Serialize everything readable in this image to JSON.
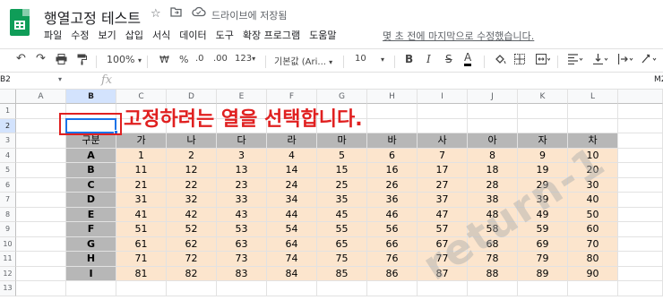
{
  "app": {
    "title": "행열고정 테스트",
    "drive_status": "드라이브에 저장됨",
    "last_edit": "몇 초 전에 마지막으로 수정했습니다.",
    "menu": [
      "파일",
      "수정",
      "보기",
      "삽입",
      "서식",
      "데이터",
      "도구",
      "확장 프로그램",
      "도움말"
    ]
  },
  "toolbar": {
    "zoom": "100%",
    "currency": "₩",
    "percent": "%",
    "dec_decrease": ".0",
    "dec_increase": ".00",
    "more_formats": "123",
    "font": "기본값 (Ari...",
    "font_size": "10",
    "bold": "B",
    "italic": "I",
    "strike": "S",
    "text_color": "A"
  },
  "formula_bar": {
    "name_box": "B2",
    "fx": "fx",
    "value": "M2"
  },
  "sheet": {
    "columns": [
      "A",
      "B",
      "C",
      "D",
      "E",
      "F",
      "G",
      "H",
      "I",
      "J",
      "K",
      "L"
    ],
    "rows": [
      "1",
      "2",
      "3",
      "4",
      "5",
      "6",
      "7",
      "8",
      "9",
      "10",
      "11",
      "12",
      "13"
    ],
    "selected_col": "B",
    "selected_row": "2",
    "header_label": "구분",
    "col_labels": [
      "가",
      "나",
      "다",
      "라",
      "마",
      "바",
      "사",
      "아",
      "자",
      "차"
    ],
    "row_labels": [
      "A",
      "B",
      "C",
      "D",
      "E",
      "F",
      "G",
      "H",
      "I"
    ],
    "values": [
      [
        "1",
        "2",
        "3",
        "4",
        "5",
        "6",
        "7",
        "8",
        "9",
        "10"
      ],
      [
        "11",
        "12",
        "13",
        "14",
        "15",
        "16",
        "17",
        "18",
        "19",
        "20"
      ],
      [
        "21",
        "22",
        "23",
        "24",
        "25",
        "26",
        "27",
        "28",
        "29",
        "30"
      ],
      [
        "31",
        "32",
        "33",
        "34",
        "35",
        "36",
        "37",
        "38",
        "39",
        "40"
      ],
      [
        "41",
        "42",
        "43",
        "44",
        "45",
        "46",
        "47",
        "48",
        "49",
        "50"
      ],
      [
        "51",
        "52",
        "53",
        "54",
        "55",
        "56",
        "57",
        "58",
        "59",
        "60"
      ],
      [
        "61",
        "62",
        "63",
        "64",
        "65",
        "66",
        "67",
        "68",
        "69",
        "70"
      ],
      [
        "71",
        "72",
        "73",
        "74",
        "75",
        "76",
        "77",
        "78",
        "79",
        "80"
      ],
      [
        "81",
        "82",
        "83",
        "84",
        "85",
        "86",
        "87",
        "88",
        "89",
        "90"
      ]
    ]
  },
  "annotation": "고정하려는 열을 선택합니다.",
  "watermark": "return-1",
  "colors": {
    "header_gray": "#b7b7b7",
    "peach": "#fce5cd",
    "annotation_red": "#e02020",
    "select_blue": "#1a73e8"
  }
}
